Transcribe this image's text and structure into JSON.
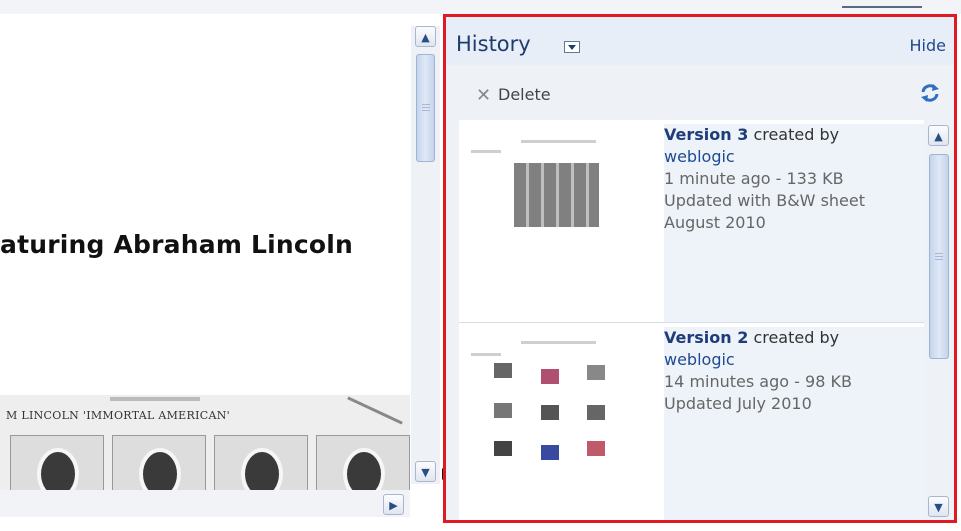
{
  "viewer": {
    "title_fragment": "aturing Abraham Lincoln",
    "caption_fragment": "M LINCOLN 'IMMORTAL AMERICAN'"
  },
  "history": {
    "title": "History",
    "hide_label": "Hide",
    "delete_label": "Delete",
    "versions": [
      {
        "name": "Version 3",
        "created_by_text": "created by",
        "user": "weblogic",
        "age": "1 minute ago",
        "separator": "-",
        "size": "133 KB",
        "comment_line1": "Updated with B&W sheet",
        "comment_line2": "August 2010"
      },
      {
        "name": "Version 2",
        "created_by_text": "created by",
        "user": "weblogic",
        "age": "14 minutes ago",
        "separator": "-",
        "size": "98 KB",
        "comment_line1": "Updated July 2010",
        "comment_line2": ""
      }
    ]
  },
  "colors": {
    "panel_border": "#e01a22",
    "link": "#1f4a92",
    "version_name": "#1f3c7a"
  },
  "icons": {
    "delete": "delete-x-icon",
    "refresh": "refresh-icon",
    "dropdown": "chevron-down-icon"
  }
}
